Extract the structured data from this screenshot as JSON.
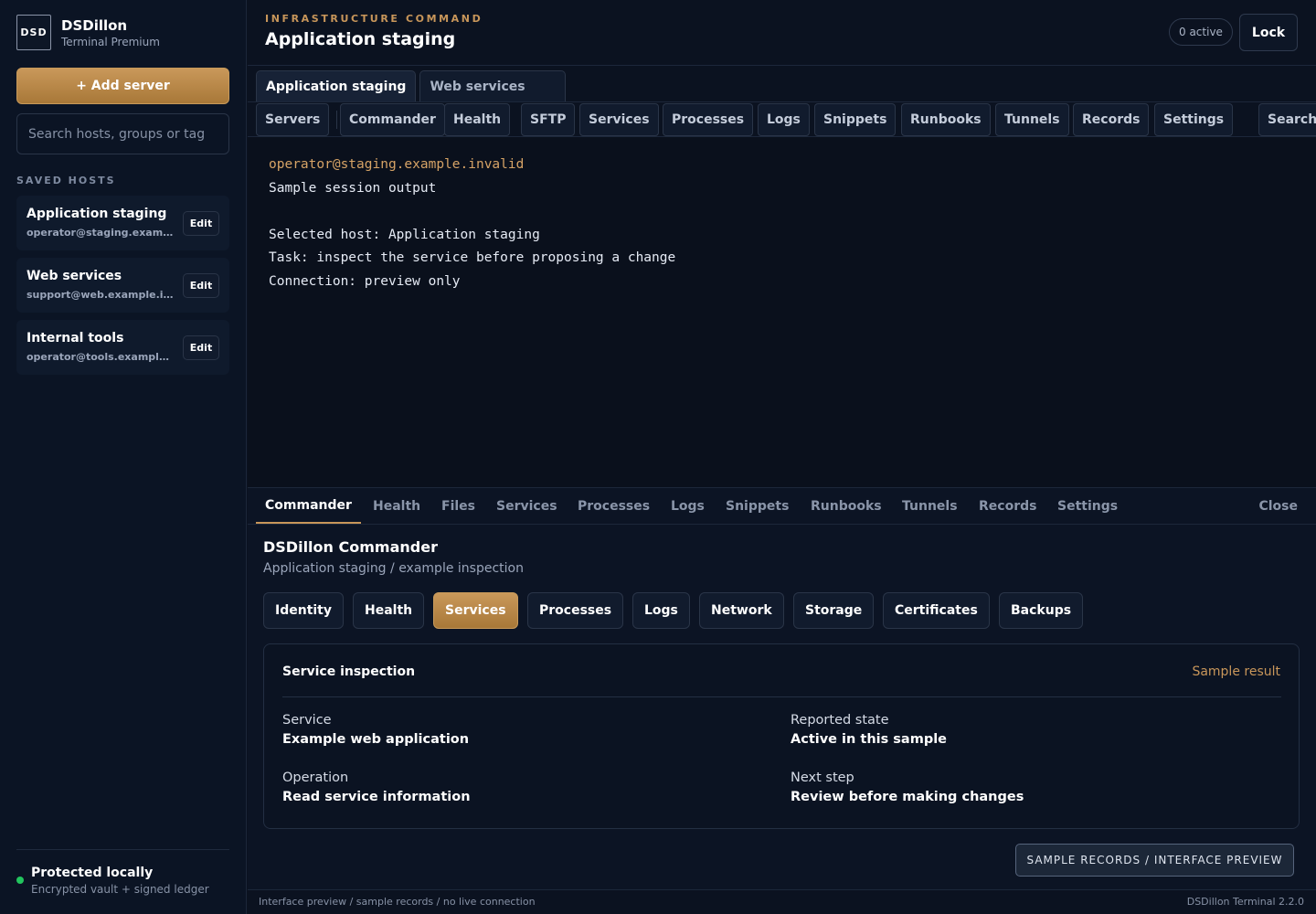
{
  "brand": {
    "logo": "DSD",
    "name": "DSDillon",
    "subtitle": "Terminal Premium"
  },
  "sidebar": {
    "add_server_label": "+ Add server",
    "search_placeholder": "Search hosts, groups or tag",
    "saved_hosts_label": "SAVED HOSTS",
    "hosts": [
      {
        "name": "Application staging",
        "address": "operator@staging.example.invalid",
        "edit_label": "Edit"
      },
      {
        "name": "Web services",
        "address": "support@web.example.invalid",
        "edit_label": "Edit"
      },
      {
        "name": "Internal tools",
        "address": "operator@tools.example.invalid",
        "edit_label": "Edit"
      }
    ],
    "status": {
      "title": "Protected locally",
      "subtitle": "Encrypted vault + signed ledger",
      "color": "#22c55e"
    }
  },
  "header": {
    "eyebrow": "INFRASTRUCTURE COMMAND",
    "title": "Application staging",
    "active_count": "0 active",
    "lock_label": "Lock"
  },
  "session_tabs": [
    {
      "label": "Application staging",
      "active": true
    },
    {
      "label": "Web services",
      "active": false
    }
  ],
  "toolbar": [
    "Servers",
    "Commander",
    "Health",
    "SFTP",
    "Services",
    "Processes",
    "Logs",
    "Snippets",
    "Runbooks",
    "Tunnels",
    "Records",
    "Settings",
    "Search"
  ],
  "terminal": {
    "prompt": "operator@staging.example.invalid",
    "lines": [
      "Sample session output",
      "",
      "Selected host: Application staging",
      "Task: inspect the service before proposing a change",
      "Connection: preview only"
    ]
  },
  "panel": {
    "tabs": [
      "Commander",
      "Health",
      "Files",
      "Services",
      "Processes",
      "Logs",
      "Snippets",
      "Runbooks",
      "Tunnels",
      "Records",
      "Settings"
    ],
    "active_tab": "Commander",
    "close_label": "Close",
    "title": "DSDillon Commander",
    "subtitle": "Application staging / example inspection",
    "chips": [
      "Identity",
      "Health",
      "Services",
      "Processes",
      "Logs",
      "Network",
      "Storage",
      "Certificates",
      "Backups"
    ],
    "active_chip": "Services",
    "card": {
      "title": "Service inspection",
      "tag": "Sample result",
      "fields": [
        {
          "label": "Service",
          "value": "Example web application"
        },
        {
          "label": "Reported state",
          "value": "Active in this sample"
        },
        {
          "label": "Operation",
          "value": "Read service information"
        },
        {
          "label": "Next step",
          "value": "Review before making changes"
        }
      ]
    },
    "preview_badge": "SAMPLE RECORDS / INTERFACE PREVIEW"
  },
  "footer": {
    "left": "Interface preview / sample records / no live connection",
    "right": "DSDillon Terminal 2.2.0"
  },
  "colors": {
    "accent": "#c8965a",
    "background": "#0b1220"
  }
}
